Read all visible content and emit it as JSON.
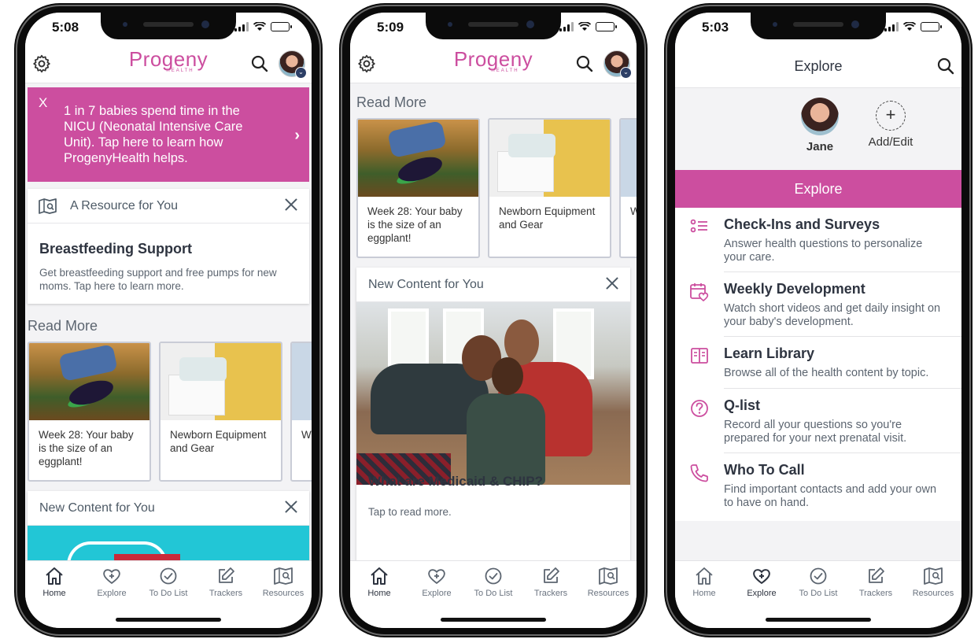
{
  "colors": {
    "brand": "#cc4e9f",
    "tab_active": "#2e3440",
    "text_muted": "#5c6570"
  },
  "phones": [
    {
      "status_time": "5:08",
      "logo": {
        "word": "Progeny",
        "sub": "HEALTH"
      },
      "banner": {
        "close": "X",
        "text": "1 in 7 babies spend time in the NICU (Neonatal Intensive Care Unit). Tap here to learn how ProgenyHealth helps.",
        "arrow": "›"
      },
      "resource_card": {
        "header": "A Resource for You",
        "title": "Breastfeeding Support",
        "body": "Get breastfeeding support and free pumps for new moms. Tap here to learn more."
      },
      "read_more": {
        "title": "Read More",
        "tiles": [
          {
            "caption": "Week 28: Your baby is the size of an eggplant!"
          },
          {
            "caption": "Newborn Equipment and Gear"
          },
          {
            "caption": "Wh Co"
          }
        ]
      },
      "new_content": {
        "header": "New Content for You"
      },
      "active_tab": "Home"
    },
    {
      "status_time": "5:09",
      "logo": {
        "word": "Progeny",
        "sub": "HEALTH"
      },
      "read_more": {
        "title": "Read More",
        "tiles": [
          {
            "caption": "Week 28: Your baby is the size of an eggplant!"
          },
          {
            "caption": "Newborn Equipment and Gear"
          },
          {
            "caption": "W Co"
          }
        ]
      },
      "new_content": {
        "header": "New Content for You",
        "title": "What are Medicaid & CHIP?",
        "sub": "Tap to read more."
      },
      "active_tab": "Home"
    },
    {
      "status_time": "5:03",
      "title": "Explore",
      "profiles": [
        {
          "name": "Jane"
        },
        {
          "name": "Add/Edit",
          "symbol": "+"
        }
      ],
      "band": "Explore",
      "items": [
        {
          "title": "Check-Ins and Surveys",
          "desc": "Answer health questions to personalize your care.",
          "icon": "checklist-icon"
        },
        {
          "title": "Weekly Development",
          "desc": "Watch short videos and get daily insight on your baby's development.",
          "icon": "calendar-heart-icon"
        },
        {
          "title": "Learn Library",
          "desc": "Browse all of the health content by topic.",
          "icon": "book-icon"
        },
        {
          "title": "Q-list",
          "desc": "Record all your questions so you're prepared for your next prenatal visit.",
          "icon": "question-icon"
        },
        {
          "title": "Who To Call",
          "desc": "Find important contacts and add your own to have on hand.",
          "icon": "phone-icon"
        }
      ],
      "active_tab": "Explore"
    }
  ],
  "tabs": [
    {
      "label": "Home",
      "icon": "home-icon"
    },
    {
      "label": "Explore",
      "icon": "heart-plus-icon"
    },
    {
      "label": "To Do List",
      "icon": "check-circle-icon"
    },
    {
      "label": "Trackers",
      "icon": "edit-icon"
    },
    {
      "label": "Resources",
      "icon": "map-icon"
    }
  ]
}
